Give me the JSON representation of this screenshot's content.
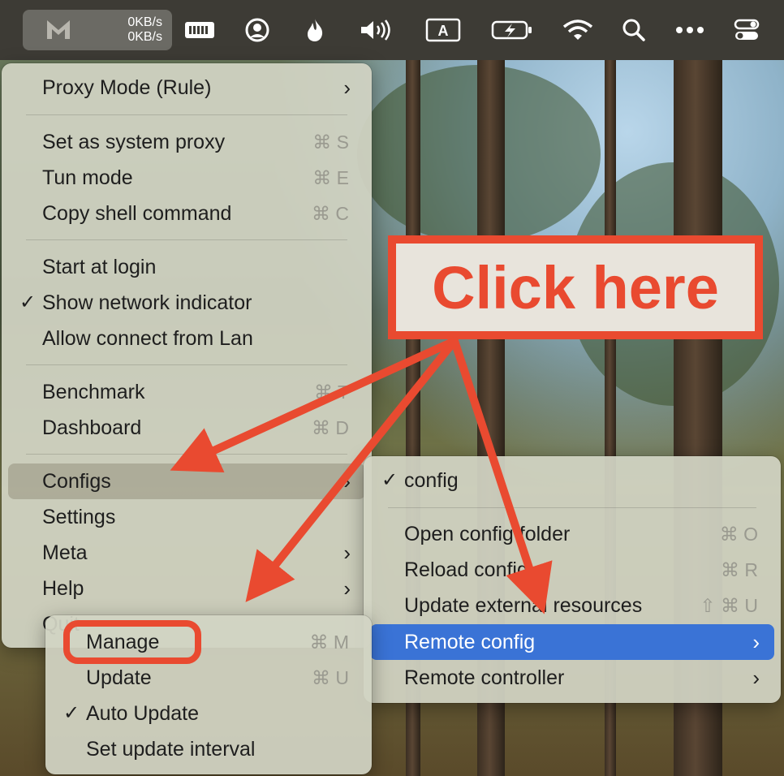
{
  "menubar": {
    "upload_speed": "0KB/s",
    "download_speed": "0KB/s",
    "icons": [
      "clash-m-icon",
      "keyboard-icon",
      "user-circle-icon",
      "flame-icon",
      "volume-icon",
      "text-input-icon",
      "battery-charging-icon",
      "wifi-icon",
      "search-icon",
      "more-icon",
      "control-center-icon"
    ]
  },
  "main_menu": {
    "items": [
      {
        "label": "Proxy Mode (Rule)",
        "shortcut": "",
        "submenu": true
      },
      {
        "label": "Set as system proxy",
        "shortcut": "⌘ S"
      },
      {
        "label": "Tun mode",
        "shortcut": "⌘ E"
      },
      {
        "label": "Copy shell command",
        "shortcut": "⌘ C"
      },
      {
        "label": "Start at login",
        "shortcut": ""
      },
      {
        "label": "Show network indicator",
        "shortcut": "",
        "checked": true
      },
      {
        "label": "Allow connect from Lan",
        "shortcut": ""
      },
      {
        "label": "Benchmark",
        "shortcut": "⌘ T"
      },
      {
        "label": "Dashboard",
        "shortcut": "⌘ D"
      },
      {
        "label": "Configs",
        "submenu": true
      },
      {
        "label": "Settings"
      },
      {
        "label": "Meta",
        "submenu": true
      },
      {
        "label": "Help",
        "submenu": true
      },
      {
        "label": "Quit"
      }
    ],
    "check_mark": "✓",
    "arrow": "›"
  },
  "configs_menu": {
    "items": [
      {
        "label": "config",
        "checked": true
      },
      {
        "label": "Open config folder",
        "shortcut": "⌘ O"
      },
      {
        "label": "Reload config",
        "shortcut": "⌘ R"
      },
      {
        "label": "Update external resources",
        "shortcut": "⇧ ⌘ U"
      },
      {
        "label": "Remote config",
        "submenu": true
      },
      {
        "label": "Remote controller",
        "submenu": true
      }
    ]
  },
  "remote_menu": {
    "items": [
      {
        "label": "Manage",
        "shortcut": "⌘ M"
      },
      {
        "label": "Update",
        "shortcut": "⌘ U"
      },
      {
        "label": "Auto Update",
        "checked": true
      },
      {
        "label": "Set update interval"
      }
    ]
  },
  "annotation": {
    "callout_text": "Click here",
    "color": "#e94a30"
  },
  "colors": {
    "menu_bg": "#d2d4c4",
    "selection": "#3a73d6",
    "accent_red": "#e94a30"
  }
}
